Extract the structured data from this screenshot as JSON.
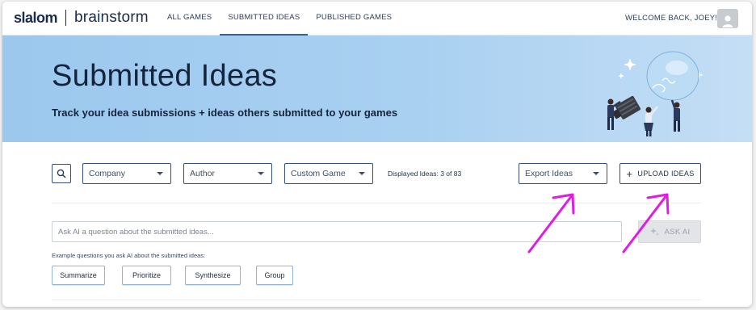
{
  "brand": {
    "logo_primary": "slalom",
    "logo_secondary": "brainstorm"
  },
  "nav": {
    "items": [
      {
        "label": "ALL GAMES"
      },
      {
        "label": "SUBMITTED IDEAS"
      },
      {
        "label": "PUBLISHED GAMES"
      }
    ],
    "welcome": "WELCOME BACK, JOEY!"
  },
  "hero": {
    "title": "Submitted Ideas",
    "subtitle": "Track your idea submissions + ideas others submitted to your games"
  },
  "filters": {
    "company": "Company",
    "author": "Author",
    "custom_game": "Custom Game",
    "displayed": "Displayed Ideas: 3 of 83",
    "export": "Export Ideas",
    "upload": "UPLOAD IDEAS"
  },
  "ai": {
    "placeholder": "Ask AI a question about the submitted ideas...",
    "ask_label": "ASK AI",
    "example_label": "Example questions you ask AI about the submitted ideas:",
    "chips": [
      "Summarize",
      "Prioritize",
      "Synthesize",
      "Group"
    ]
  },
  "colors": {
    "navy": "#1a2b4c",
    "hero_blue": "#a9d0f1",
    "border": "#35507a",
    "annotation": "#e01ce0"
  }
}
